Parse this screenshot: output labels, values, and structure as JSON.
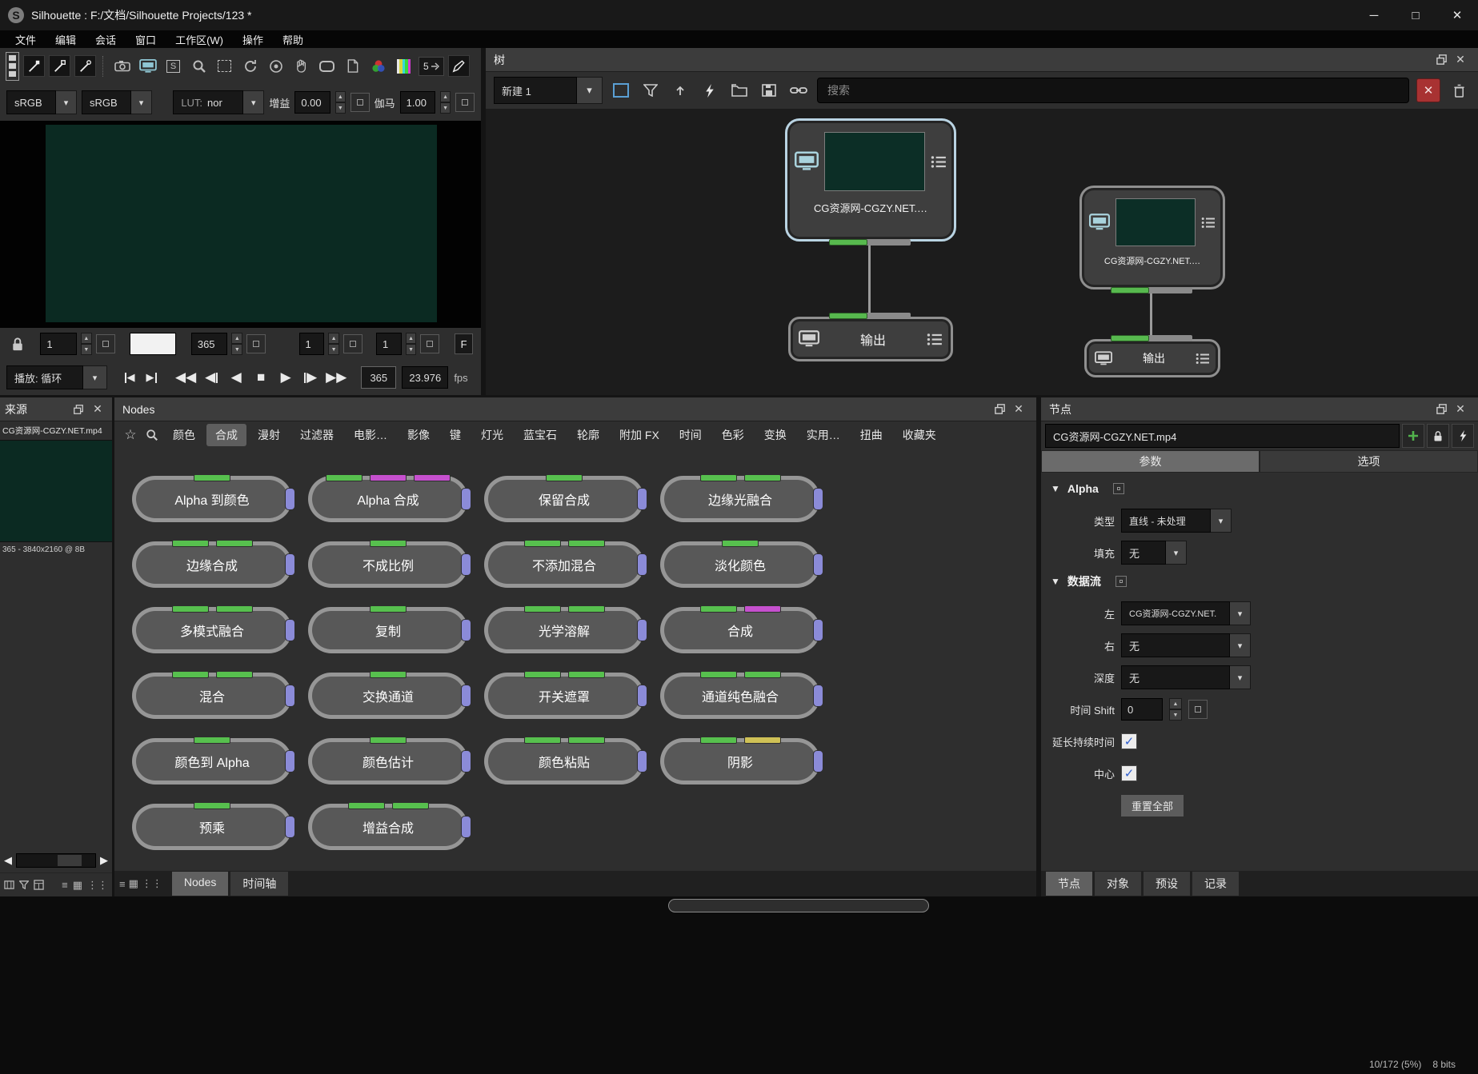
{
  "window": {
    "title": "Silhouette : F:/文档/Silhouette Projects/123 *"
  },
  "menu": {
    "items": [
      "文件",
      "编辑",
      "会话",
      "窗口",
      "工作区(W)",
      "操作",
      "帮助"
    ]
  },
  "viewer": {
    "colorspace_left": "sRGB",
    "colorspace_right": "sRGB",
    "lut_label": "LUT:",
    "lut_value": "nor",
    "gain_label": "增益",
    "gain_value": "0.00",
    "gamma_label": "伽马",
    "gamma_value": "1.00",
    "step_frames": "5"
  },
  "timeline": {
    "in_value": "1",
    "current_value": "",
    "end_value": "365",
    "step_value": "1",
    "sub_value": "1",
    "field_button": "F",
    "play_mode": "播放: 循环",
    "duration": "365",
    "fps": "23.976",
    "fps_label": "fps"
  },
  "tree": {
    "title": "树",
    "session_label": "新建 1",
    "search_placeholder": "搜索",
    "source_node": {
      "label": "CG资源网-CGZY.NET.…"
    },
    "source_node2": {
      "label": "CG资源网-CGZY.NET.…"
    },
    "output_label": "输出"
  },
  "source_panel": {
    "title": "来源",
    "file_name": "CG资源网-CGZY.NET.mp4",
    "clip_info": "365 - 3840x2160 @ 8B"
  },
  "nodes_panel": {
    "title": "Nodes",
    "tabs": [
      "颜色",
      "合成",
      "漫射",
      "过滤器",
      "电影…",
      "影像",
      "键",
      "灯光",
      "蓝宝石",
      "轮廓",
      "附加 FX",
      "时间",
      "色彩",
      "变换",
      "实用…",
      "扭曲",
      "收藏夹"
    ],
    "active_tab": "合成",
    "nodes": [
      {
        "label": "Alpha 到颜色",
        "strips": [
          "green"
        ]
      },
      {
        "label": "Alpha 合成",
        "strips": [
          "green",
          "magenta",
          "magenta"
        ]
      },
      {
        "label": "保留合成",
        "strips": [
          "green"
        ]
      },
      {
        "label": "边缘光融合",
        "strips": [
          "green",
          "green"
        ]
      },
      {
        "label": "边缘合成",
        "strips": [
          "green",
          "green"
        ]
      },
      {
        "label": "不成比例",
        "strips": [
          "green"
        ]
      },
      {
        "label": "不添加混合",
        "strips": [
          "green",
          "green"
        ]
      },
      {
        "label": "淡化颜色",
        "strips": [
          "green"
        ]
      },
      {
        "label": "多模式融合",
        "strips": [
          "green",
          "green"
        ]
      },
      {
        "label": "复制",
        "strips": [
          "green"
        ]
      },
      {
        "label": "光学溶解",
        "strips": [
          "green",
          "green"
        ]
      },
      {
        "label": "合成",
        "strips": [
          "green",
          "magenta"
        ]
      },
      {
        "label": "混合",
        "strips": [
          "green",
          "green"
        ]
      },
      {
        "label": "交换通道",
        "strips": [
          "green"
        ]
      },
      {
        "label": "开关遮罩",
        "strips": [
          "green",
          "green"
        ]
      },
      {
        "label": "通道纯色融合",
        "strips": [
          "green",
          "green"
        ]
      },
      {
        "label": "颜色到 Alpha",
        "strips": [
          "green"
        ]
      },
      {
        "label": "颜色估计",
        "strips": [
          "green"
        ]
      },
      {
        "label": "颜色粘贴",
        "strips": [
          "green",
          "green"
        ]
      },
      {
        "label": "阴影",
        "strips": [
          "green",
          "yellow"
        ]
      },
      {
        "label": "预乘",
        "strips": [
          "green"
        ]
      },
      {
        "label": "增益合成",
        "strips": [
          "green",
          "green"
        ]
      }
    ],
    "bottom_tabs": [
      "Nodes",
      "时间轴"
    ],
    "active_bottom_tab": "Nodes"
  },
  "node_panel": {
    "title": "节点",
    "file_name": "CG资源网-CGZY.NET.mp4",
    "tabs": [
      "参数",
      "选项"
    ],
    "active_tab": "参数",
    "alpha_section": {
      "title": "Alpha",
      "type_label": "类型",
      "type_value": "直线 - 未处理",
      "fill_label": "填充",
      "fill_value": "无"
    },
    "stream_section": {
      "title": "数据流",
      "left_label": "左",
      "left_value": "CG资源网-CGZY.NET.",
      "right_label": "右",
      "right_value": "无",
      "depth_label": "深度",
      "depth_value": "无",
      "shift_label": "时间 Shift",
      "shift_value": "0",
      "extend_label": "延长持续时间",
      "center_label": "中心",
      "reset_button": "重置全部"
    },
    "bottom_tabs": [
      "节点",
      "对象",
      "预设",
      "记录"
    ],
    "active_bottom_tab": "节点"
  },
  "status": {
    "memory": "10/172 (5%)",
    "bit_depth": "8 bits"
  },
  "colors": {
    "strip_green": "#57c04e",
    "strip_magenta": "#c650ce",
    "strip_yellow": "#cfc156",
    "node_tab_blue": "#8b8bd8",
    "selection_blue": "#b9d3e2",
    "viewer_green": "#0b2a22",
    "clear_red": "#a83232"
  }
}
